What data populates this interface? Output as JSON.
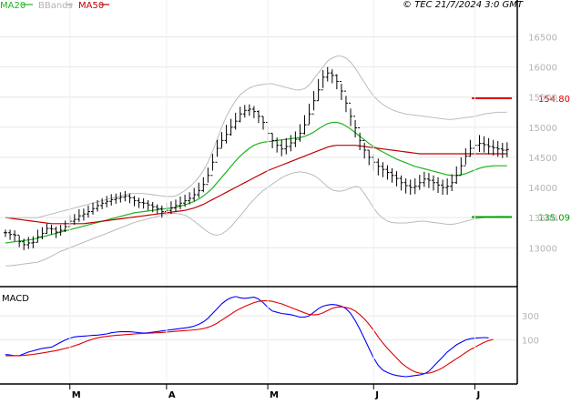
{
  "header": {
    "timestamp": "© TEC 21/7/2024 3:0 GMT",
    "legend": [
      {
        "label": "MA20",
        "color": "#1fb31f"
      },
      {
        "label": "BBands",
        "color": "#b4b4b4"
      },
      {
        "label": "MA50",
        "color": "#c00000"
      }
    ]
  },
  "macd_panel": {
    "label": "MACD"
  },
  "chart_data": [
    {
      "type": "ohlc",
      "title": "",
      "y_ticks": [
        "16500",
        "16000",
        "15500",
        "15000",
        "14500",
        "14000",
        "13500",
        "13000"
      ],
      "ylim": [
        12400,
        16900
      ],
      "x_ticks": [
        "M",
        "A",
        "M",
        "J",
        "J"
      ],
      "x_tick_indices": [
        14,
        35,
        57,
        80,
        102
      ],
      "grid": true,
      "levels": [
        {
          "label": "154.80",
          "value": 15480,
          "color": "#e00000"
        },
        {
          "label": "135.09",
          "value": 13509,
          "color": "#00a000"
        }
      ],
      "close": [
        13250,
        13220,
        13210,
        13100,
        13050,
        13080,
        13090,
        13180,
        13240,
        13320,
        13310,
        13260,
        13290,
        13350,
        13440,
        13470,
        13530,
        13560,
        13600,
        13650,
        13700,
        13740,
        13770,
        13800,
        13820,
        13840,
        13860,
        13830,
        13780,
        13750,
        13740,
        13710,
        13680,
        13650,
        13600,
        13620,
        13660,
        13700,
        13740,
        13780,
        13820,
        13880,
        13950,
        14050,
        14200,
        14420,
        14650,
        14780,
        14880,
        15000,
        15100,
        15220,
        15280,
        15300,
        15260,
        15180,
        15080,
        14900,
        14780,
        14700,
        14640,
        14680,
        14740,
        14800,
        14900,
        15040,
        15220,
        15440,
        15620,
        15830,
        15900,
        15860,
        15760,
        15600,
        15400,
        15180,
        14990,
        14780,
        14620,
        14500,
        14420,
        14350,
        14300,
        14250,
        14200,
        14150,
        14080,
        14030,
        14000,
        14020,
        14080,
        14140,
        14120,
        14080,
        14040,
        14000,
        14020,
        14080,
        14200,
        14360,
        14520,
        14650,
        14700,
        14730,
        14710,
        14680,
        14660,
        14640,
        14620,
        14630
      ],
      "high": [
        13300,
        13300,
        13290,
        13200,
        13150,
        13180,
        13190,
        13300,
        13340,
        13400,
        13380,
        13350,
        13380,
        13450,
        13540,
        13560,
        13640,
        13650,
        13700,
        13750,
        13790,
        13820,
        13860,
        13890,
        13900,
        13920,
        13940,
        13900,
        13860,
        13830,
        13820,
        13790,
        13760,
        13720,
        13700,
        13750,
        13770,
        13800,
        13850,
        13880,
        13920,
        13990,
        14080,
        14170,
        14330,
        14560,
        14790,
        14920,
        15040,
        15140,
        15240,
        15340,
        15370,
        15380,
        15350,
        15280,
        15180,
        15020,
        14900,
        14830,
        14790,
        14820,
        14870,
        14930,
        15050,
        15200,
        15390,
        15600,
        15800,
        15950,
        16000,
        15960,
        15880,
        15720,
        15520,
        15310,
        15120,
        14910,
        14740,
        14620,
        14550,
        14480,
        14420,
        14370,
        14320,
        14270,
        14200,
        14150,
        14130,
        14150,
        14210,
        14260,
        14240,
        14200,
        14170,
        14130,
        14150,
        14220,
        14350,
        14500,
        14650,
        14790,
        14840,
        14870,
        14850,
        14820,
        14790,
        14770,
        14740,
        14750
      ],
      "low": [
        13180,
        13130,
        13110,
        13010,
        12960,
        12980,
        12990,
        13090,
        13140,
        13230,
        13220,
        13160,
        13200,
        13260,
        13340,
        13380,
        13430,
        13450,
        13500,
        13550,
        13600,
        13640,
        13670,
        13700,
        13730,
        13750,
        13770,
        13740,
        13690,
        13660,
        13650,
        13620,
        13590,
        13560,
        13500,
        13520,
        13560,
        13600,
        13640,
        13680,
        13720,
        13770,
        13830,
        13920,
        14080,
        14280,
        14510,
        14660,
        14730,
        14860,
        14960,
        15080,
        15160,
        15190,
        15150,
        15070,
        14960,
        14760,
        14650,
        14580,
        14520,
        14550,
        14600,
        14670,
        14760,
        14880,
        15050,
        15280,
        15440,
        15650,
        15760,
        15730,
        15630,
        15450,
        15250,
        15020,
        14830,
        14620,
        14480,
        14370,
        14280,
        14200,
        14170,
        14130,
        14080,
        14020,
        13950,
        13900,
        13880,
        13890,
        13960,
        14010,
        13990,
        13950,
        13910,
        13880,
        13880,
        13940,
        14060,
        14210,
        14380,
        14510,
        14560,
        14590,
        14580,
        14550,
        14530,
        14510,
        14490,
        14500
      ],
      "series": [
        {
          "name": "MA20",
          "color": "#1fb31f",
          "values": [
            13080,
            13090,
            13100,
            13110,
            13120,
            13130,
            13140,
            13160,
            13180,
            13200,
            13220,
            13240,
            13260,
            13280,
            13300,
            13320,
            13340,
            13360,
            13380,
            13400,
            13420,
            13440,
            13460,
            13480,
            13500,
            13520,
            13540,
            13560,
            13580,
            13590,
            13600,
            13610,
            13620,
            13630,
            13640,
            13650,
            13660,
            13670,
            13690,
            13710,
            13740,
            13770,
            13810,
            13860,
            13920,
            13990,
            14080,
            14170,
            14260,
            14350,
            14440,
            14520,
            14590,
            14650,
            14700,
            14730,
            14750,
            14760,
            14770,
            14780,
            14790,
            14800,
            14810,
            14820,
            14830,
            14850,
            14880,
            14920,
            14970,
            15020,
            15060,
            15080,
            15080,
            15060,
            15020,
            14970,
            14910,
            14850,
            14790,
            14730,
            14680,
            14630,
            14590,
            14550,
            14510,
            14470,
            14440,
            14410,
            14380,
            14350,
            14330,
            14310,
            14290,
            14270,
            14250,
            14230,
            14210,
            14200,
            14200,
            14210,
            14230,
            14260,
            14290,
            14320,
            14340,
            14350,
            14360,
            14360,
            14360,
            14360
          ]
        },
        {
          "name": "MA50",
          "color": "#c00000",
          "values": [
            13500,
            13490,
            13480,
            13470,
            13460,
            13450,
            13440,
            13430,
            13420,
            13410,
            13400,
            13400,
            13400,
            13400,
            13400,
            13400,
            13400,
            13400,
            13410,
            13420,
            13430,
            13440,
            13450,
            13460,
            13470,
            13480,
            13490,
            13500,
            13510,
            13520,
            13530,
            13540,
            13550,
            13560,
            13570,
            13580,
            13590,
            13600,
            13610,
            13620,
            13640,
            13660,
            13690,
            13720,
            13760,
            13800,
            13840,
            13880,
            13920,
            13960,
            14000,
            14040,
            14080,
            14120,
            14160,
            14200,
            14240,
            14280,
            14310,
            14340,
            14370,
            14400,
            14430,
            14460,
            14490,
            14520,
            14550,
            14580,
            14610,
            14640,
            14670,
            14690,
            14700,
            14700,
            14700,
            14700,
            14700,
            14690,
            14680,
            14670,
            14660,
            14650,
            14640,
            14630,
            14620,
            14610,
            14600,
            14590,
            14580,
            14570,
            14560,
            14560,
            14560,
            14560,
            14560,
            14560,
            14560,
            14560,
            14560,
            14560,
            14560,
            14560,
            14560,
            14560,
            14560,
            14560,
            14560,
            14560,
            14560,
            14560
          ]
        },
        {
          "name": "BB upper",
          "color": "#b4b4b4",
          "values": [
            13500,
            13500,
            13500,
            13500,
            13500,
            13500,
            13500,
            13500,
            13520,
            13540,
            13560,
            13580,
            13600,
            13620,
            13640,
            13660,
            13680,
            13700,
            13720,
            13740,
            13760,
            13780,
            13800,
            13820,
            13840,
            13860,
            13880,
            13900,
            13900,
            13900,
            13900,
            13890,
            13880,
            13870,
            13860,
            13850,
            13850,
            13860,
            13900,
            13950,
            14010,
            14080,
            14170,
            14280,
            14420,
            14600,
            14800,
            15000,
            15180,
            15320,
            15440,
            15540,
            15600,
            15650,
            15680,
            15700,
            15710,
            15720,
            15720,
            15700,
            15680,
            15660,
            15640,
            15620,
            15620,
            15640,
            15700,
            15800,
            15900,
            16000,
            16100,
            16150,
            16180,
            16180,
            16150,
            16080,
            15980,
            15860,
            15740,
            15620,
            15520,
            15440,
            15380,
            15330,
            15290,
            15260,
            15240,
            15220,
            15210,
            15200,
            15190,
            15180,
            15170,
            15160,
            15150,
            15140,
            15130,
            15130,
            15140,
            15150,
            15160,
            15170,
            15180,
            15200,
            15220,
            15230,
            15240,
            15250,
            15250,
            15250
          ]
        },
        {
          "name": "BB lower",
          "color": "#b4b4b4",
          "values": [
            12700,
            12700,
            12710,
            12720,
            12730,
            12740,
            12750,
            12760,
            12790,
            12820,
            12860,
            12900,
            12940,
            12970,
            13000,
            13030,
            13060,
            13090,
            13120,
            13150,
            13180,
            13210,
            13240,
            13270,
            13300,
            13330,
            13360,
            13390,
            13420,
            13440,
            13460,
            13480,
            13500,
            13520,
            13540,
            13560,
            13570,
            13570,
            13560,
            13540,
            13500,
            13440,
            13380,
            13320,
            13260,
            13220,
            13210,
            13230,
            13280,
            13350,
            13440,
            13530,
            13620,
            13720,
            13800,
            13880,
            13950,
            14000,
            14060,
            14110,
            14160,
            14200,
            14230,
            14250,
            14260,
            14250,
            14230,
            14200,
            14150,
            14080,
            14010,
            13960,
            13940,
            13940,
            13960,
            13990,
            14020,
            14000,
            13900,
            13780,
            13660,
            13560,
            13490,
            13440,
            13420,
            13410,
            13410,
            13410,
            13420,
            13430,
            13440,
            13440,
            13430,
            13420,
            13410,
            13400,
            13390,
            13390,
            13400,
            13420,
            13440,
            13460,
            13480,
            13490,
            13500,
            13510,
            13510,
            13520,
            13520,
            13520
          ]
        }
      ]
    },
    {
      "type": "line",
      "title": "MACD",
      "y_ticks": [
        "300",
        "100"
      ],
      "ylim": [
        -250,
        520
      ],
      "x_ticks": [
        "M",
        "A",
        "M",
        "J",
        "J"
      ],
      "grid": true,
      "series": [
        {
          "name": "MACD",
          "color": "#0000ff",
          "values": [
            -20,
            -25,
            -30,
            -30,
            -15,
            0,
            10,
            20,
            30,
            35,
            40,
            60,
            80,
            100,
            115,
            125,
            130,
            132,
            135,
            138,
            140,
            145,
            150,
            160,
            165,
            168,
            170,
            168,
            165,
            160,
            158,
            160,
            165,
            170,
            175,
            180,
            185,
            190,
            195,
            200,
            205,
            215,
            230,
            250,
            280,
            320,
            360,
            400,
            430,
            450,
            460,
            450,
            445,
            450,
            455,
            440,
            410,
            370,
            340,
            330,
            320,
            315,
            310,
            300,
            290,
            290,
            300,
            330,
            360,
            380,
            390,
            395,
            390,
            380,
            360,
            320,
            260,
            190,
            110,
            30,
            -50,
            -110,
            -150,
            -170,
            -185,
            -195,
            -200,
            -205,
            -200,
            -195,
            -190,
            -180,
            -160,
            -120,
            -80,
            -40,
            0,
            30,
            60,
            80,
            100,
            110,
            115,
            118,
            120,
            118
          ]
        },
        {
          "name": "Signal",
          "color": "#e00000",
          "values": [
            -30,
            -30,
            -30,
            -30,
            -28,
            -24,
            -20,
            -14,
            -8,
            -2,
            5,
            12,
            20,
            30,
            40,
            52,
            65,
            80,
            95,
            108,
            118,
            125,
            130,
            134,
            138,
            141,
            144,
            147,
            150,
            152,
            154,
            156,
            158,
            160,
            162,
            165,
            168,
            172,
            175,
            178,
            180,
            184,
            188,
            195,
            205,
            220,
            240,
            265,
            290,
            315,
            340,
            360,
            378,
            395,
            410,
            420,
            425,
            425,
            420,
            410,
            400,
            385,
            370,
            355,
            340,
            325,
            312,
            308,
            312,
            325,
            345,
            362,
            372,
            375,
            370,
            360,
            340,
            310,
            275,
            230,
            180,
            125,
            75,
            30,
            -10,
            -50,
            -90,
            -120,
            -145,
            -165,
            -175,
            -178,
            -175,
            -165,
            -150,
            -130,
            -105,
            -80,
            -55,
            -30,
            -5,
            20,
            40,
            60,
            80,
            95,
            105
          ]
        }
      ]
    }
  ]
}
